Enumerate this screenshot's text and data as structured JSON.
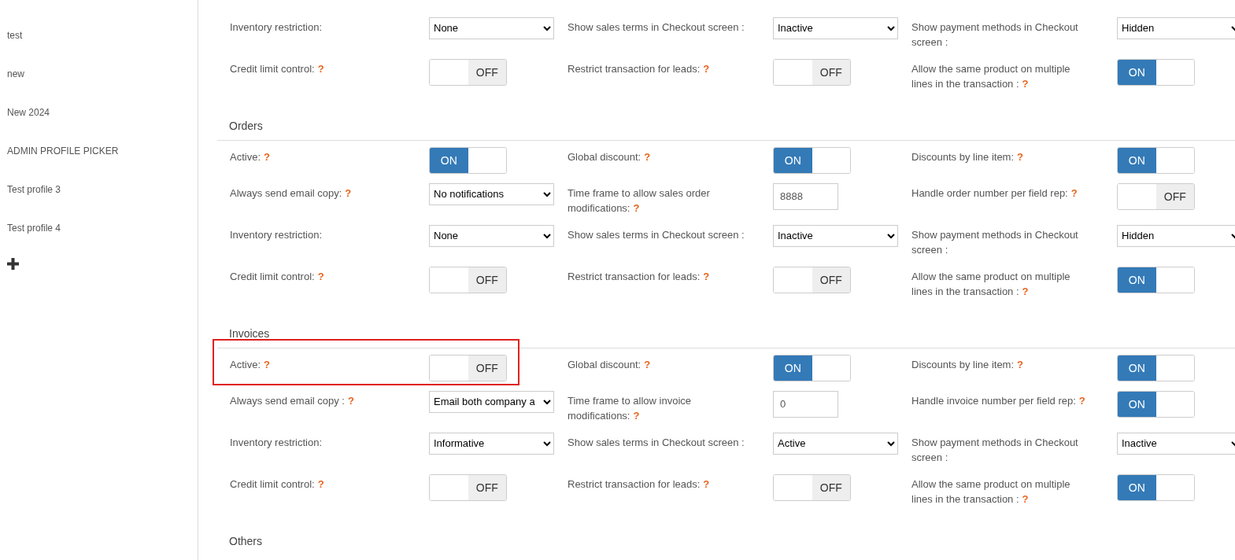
{
  "sidebar": {
    "items": [
      {
        "label": "test"
      },
      {
        "label": "new"
      },
      {
        "label": "New 2024"
      },
      {
        "label": "ADMIN PROFILE PICKER"
      },
      {
        "label": "Test profile 3"
      },
      {
        "label": "Test profile 4"
      }
    ]
  },
  "sections": [
    {
      "rows": [
        [
          {
            "label": "Inventory restriction:",
            "kind": "select",
            "value": "None"
          },
          {
            "label": "Show sales terms in Checkout screen :",
            "kind": "select",
            "value": "Inactive"
          },
          {
            "label": "Show payment methods in Checkout screen :",
            "kind": "select",
            "value": "Hidden"
          }
        ],
        [
          {
            "label": "Credit limit control:",
            "help": "?",
            "kind": "toggle",
            "on": false,
            "value": "OFF"
          },
          {
            "label": "Restrict transaction for leads:",
            "help": "?",
            "kind": "toggle",
            "on": false,
            "value": "OFF"
          },
          {
            "label": "Allow the same product on multiple lines in the transaction :",
            "help": "?",
            "kind": "toggle",
            "on": true,
            "value": "ON"
          }
        ]
      ]
    },
    {
      "title": "Orders",
      "rows": [
        [
          {
            "label": "Active:",
            "help": "?",
            "kind": "toggle",
            "on": true,
            "value": "ON"
          },
          {
            "label": "Global discount:",
            "help": "?",
            "kind": "toggle",
            "on": true,
            "value": "ON"
          },
          {
            "label": "Discounts by line item:",
            "help": "?",
            "kind": "toggle",
            "on": true,
            "value": "ON"
          }
        ],
        [
          {
            "label": "Always send email copy:",
            "help": "?",
            "kind": "select",
            "value": "No notifications"
          },
          {
            "label": "Time frame to allow sales order modifications:",
            "help": "?",
            "kind": "input",
            "value": "8888"
          },
          {
            "label": "Handle order number per field rep:",
            "help": "?",
            "kind": "toggle",
            "on": false,
            "value": "OFF"
          }
        ],
        [
          {
            "label": "Inventory restriction:",
            "kind": "select",
            "value": "None"
          },
          {
            "label": "Show sales terms in Checkout screen :",
            "kind": "select",
            "value": "Inactive"
          },
          {
            "label": "Show payment methods in Checkout screen :",
            "kind": "select",
            "value": "Hidden"
          }
        ],
        [
          {
            "label": "Credit limit control:",
            "help": "?",
            "kind": "toggle",
            "on": false,
            "value": "OFF"
          },
          {
            "label": "Restrict transaction for leads:",
            "help": "?",
            "kind": "toggle",
            "on": false,
            "value": "OFF"
          },
          {
            "label": "Allow the same product on multiple lines in the transaction :",
            "help": "?",
            "kind": "toggle",
            "on": true,
            "value": "ON"
          }
        ]
      ]
    },
    {
      "title": "Invoices",
      "rows": [
        [
          {
            "label": "Active:",
            "help": "?",
            "kind": "toggle",
            "on": false,
            "value": "OFF",
            "highlighted": true
          },
          {
            "label": "Global discount:",
            "help": "?",
            "kind": "toggle",
            "on": true,
            "value": "ON"
          },
          {
            "label": "Discounts by line item:",
            "help": "?",
            "kind": "toggle",
            "on": true,
            "value": "ON"
          }
        ],
        [
          {
            "label": "Always send email copy :",
            "help": "?",
            "kind": "select",
            "value": "Email both company a"
          },
          {
            "label": "Time frame to allow invoice modifications:",
            "help": "?",
            "kind": "input",
            "value": "0"
          },
          {
            "label": "Handle invoice number per field rep:",
            "help": "?",
            "kind": "toggle",
            "on": true,
            "value": "ON"
          }
        ],
        [
          {
            "label": "Inventory restriction:",
            "kind": "select",
            "value": "Informative"
          },
          {
            "label": "Show sales terms in Checkout screen :",
            "kind": "select",
            "value": "Active"
          },
          {
            "label": "Show payment methods in Checkout screen :",
            "kind": "select",
            "value": "Inactive"
          }
        ],
        [
          {
            "label": "Credit limit control:",
            "help": "?",
            "kind": "toggle",
            "on": false,
            "value": "OFF"
          },
          {
            "label": "Restrict transaction for leads:",
            "help": "?",
            "kind": "toggle",
            "on": false,
            "value": "OFF"
          },
          {
            "label": "Allow the same product on multiple lines in the transaction :",
            "help": "?",
            "kind": "toggle",
            "on": true,
            "value": "ON"
          }
        ]
      ]
    },
    {
      "title": "Others"
    }
  ]
}
